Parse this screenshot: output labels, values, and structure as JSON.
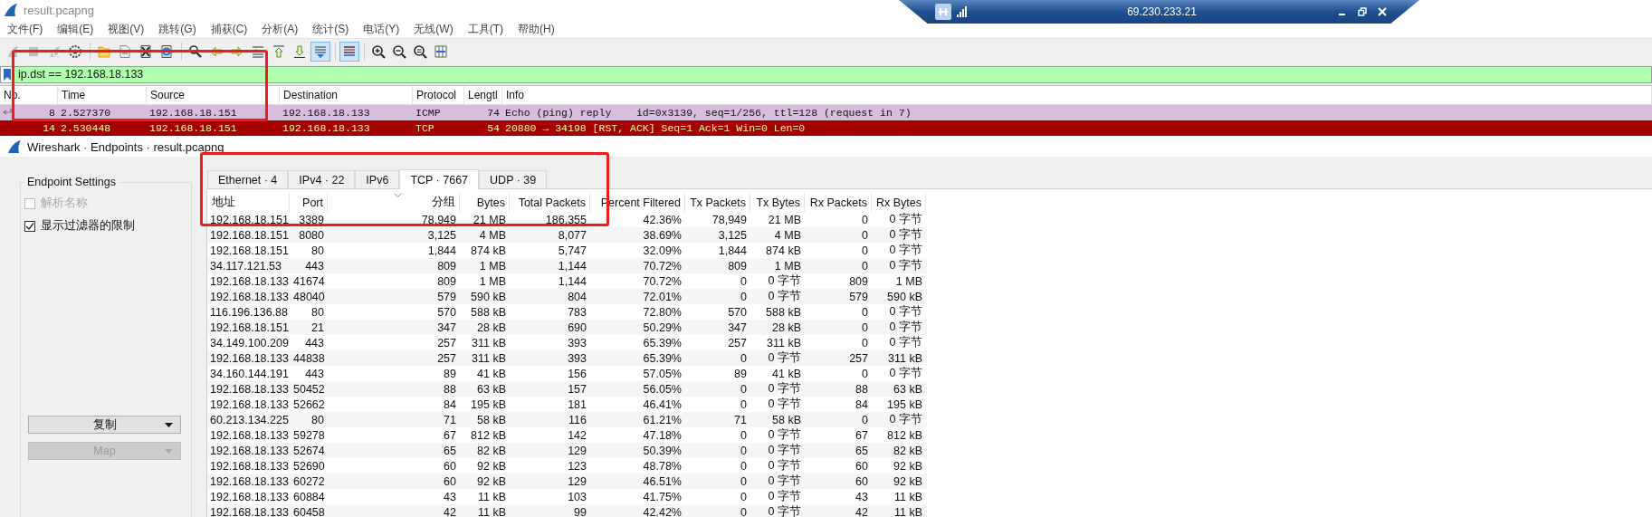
{
  "window": {
    "title": "result.pcapng"
  },
  "remote_bar": {
    "host": "69.230.233.21"
  },
  "menu": [
    "文件(F)",
    "编辑(E)",
    "视图(V)",
    "跳转(G)",
    "捕获(C)",
    "分析(A)",
    "统计(S)",
    "电话(Y)",
    "无线(W)",
    "工具(T)",
    "帮助(H)"
  ],
  "toolbar": [
    [
      {
        "kind": "fin",
        "disabled": true,
        "pressed": false
      },
      {
        "kind": "stop",
        "disabled": true,
        "pressed": false
      },
      {
        "kind": "restart",
        "disabled": true,
        "pressed": false
      },
      {
        "kind": "gear",
        "disabled": false,
        "pressed": false
      }
    ],
    [
      {
        "kind": "folder",
        "disabled": false,
        "pressed": false
      },
      {
        "kind": "document",
        "disabled": false,
        "pressed": false
      },
      {
        "kind": "close",
        "disabled": false,
        "pressed": false
      },
      {
        "kind": "reload",
        "disabled": false,
        "pressed": false
      }
    ],
    [
      {
        "kind": "search",
        "disabled": false,
        "pressed": false
      },
      {
        "kind": "back",
        "disabled": false,
        "pressed": false
      },
      {
        "kind": "forward",
        "disabled": false,
        "pressed": false
      },
      {
        "kind": "jump",
        "disabled": false,
        "pressed": false
      },
      {
        "kind": "first",
        "disabled": false,
        "pressed": false
      },
      {
        "kind": "last",
        "disabled": false,
        "pressed": false
      },
      {
        "kind": "autoscroll",
        "disabled": false,
        "pressed": true
      }
    ],
    [
      {
        "kind": "colorize",
        "disabled": false,
        "pressed": true
      }
    ],
    [
      {
        "kind": "zoom_in",
        "disabled": false,
        "pressed": false
      },
      {
        "kind": "zoom_out",
        "disabled": false,
        "pressed": false
      },
      {
        "kind": "zoom_reset",
        "disabled": false,
        "pressed": false
      },
      {
        "kind": "resize",
        "disabled": false,
        "pressed": false
      }
    ]
  ],
  "display_filter": {
    "value": "ip.dst == 192.168.18.133",
    "highlighted": true
  },
  "packet_list": {
    "columns": [
      "No.",
      "Time",
      "Source",
      "Destination",
      "Protocol",
      "Lengtl",
      "Info"
    ],
    "rows": [
      {
        "color": "#d7bfdb",
        "related": true,
        "cells": [
          "8",
          "2.527370",
          "192.168.18.151",
          "192.168.18.133",
          "ICMP",
          "74",
          "Echo (ping) reply    id=0x3139, seq=1/256, ttl=128 (request in 7)"
        ]
      },
      {
        "color": "#a40000",
        "related": false,
        "cells": [
          "14",
          "2.530448",
          "192.168.18.151",
          "192.168.18.133",
          "TCP",
          "54",
          "20880 → 34198 [RST, ACK] Seq=1 Ack=1 Win=0 Len=0"
        ]
      }
    ]
  },
  "endpoints": {
    "title": "Wireshark · Endpoints · result.pcapng",
    "highlighted": true,
    "settings": {
      "title": "Endpoint Settings",
      "options": [
        {
          "label": "解析名称",
          "checked": false,
          "disabled": true
        },
        {
          "label": "显示过滤器的限制",
          "checked": true,
          "disabled": false
        }
      ],
      "buttons": [
        {
          "label": "复制",
          "disabled": false
        },
        {
          "label": "Map",
          "disabled": true
        }
      ]
    },
    "tabs": [
      {
        "label": "Ethernet · 4",
        "selected": false
      },
      {
        "label": "IPv4 · 22",
        "selected": false
      },
      {
        "label": "IPv6",
        "selected": false
      },
      {
        "label": "TCP · 7667",
        "selected": true
      },
      {
        "label": "UDP · 39",
        "selected": false
      }
    ],
    "table": {
      "columns": [
        {
          "label": "地址",
          "sorted": false
        },
        {
          "label": "Port",
          "sorted": false
        },
        {
          "label": "分组",
          "sorted": true
        },
        {
          "label": "Bytes",
          "sorted": false
        },
        {
          "label": "Total Packets",
          "sorted": false
        },
        {
          "label": "Percent Filtered",
          "sorted": false
        },
        {
          "label": "Tx Packets",
          "sorted": false
        },
        {
          "label": "Tx Bytes",
          "sorted": false
        },
        {
          "label": "Rx Packets",
          "sorted": false
        },
        {
          "label": "Rx Bytes",
          "sorted": false
        }
      ],
      "rows": [
        [
          "192.168.18.151",
          "3389",
          "78,949",
          "21 MB",
          "186,355",
          "42.36%",
          "78,949",
          "21 MB",
          "0",
          "0 字节"
        ],
        [
          "192.168.18.151",
          "8080",
          "3,125",
          "4 MB",
          "8,077",
          "38.69%",
          "3,125",
          "4 MB",
          "0",
          "0 字节"
        ],
        [
          "192.168.18.151",
          "80",
          "1,844",
          "874 kB",
          "5,747",
          "32.09%",
          "1,844",
          "874 kB",
          "0",
          "0 字节"
        ],
        [
          "34.117.121.53",
          "443",
          "809",
          "1 MB",
          "1,144",
          "70.72%",
          "809",
          "1 MB",
          "0",
          "0 字节"
        ],
        [
          "192.168.18.133",
          "41674",
          "809",
          "1 MB",
          "1,144",
          "70.72%",
          "0",
          "0 字节",
          "809",
          "1 MB"
        ],
        [
          "192.168.18.133",
          "48040",
          "579",
          "590 kB",
          "804",
          "72.01%",
          "0",
          "0 字节",
          "579",
          "590 kB"
        ],
        [
          "116.196.136.88",
          "80",
          "570",
          "588 kB",
          "783",
          "72.80%",
          "570",
          "588 kB",
          "0",
          "0 字节"
        ],
        [
          "192.168.18.151",
          "21",
          "347",
          "28 kB",
          "690",
          "50.29%",
          "347",
          "28 kB",
          "0",
          "0 字节"
        ],
        [
          "34.149.100.209",
          "443",
          "257",
          "311 kB",
          "393",
          "65.39%",
          "257",
          "311 kB",
          "0",
          "0 字节"
        ],
        [
          "192.168.18.133",
          "44838",
          "257",
          "311 kB",
          "393",
          "65.39%",
          "0",
          "0 字节",
          "257",
          "311 kB"
        ],
        [
          "34.160.144.191",
          "443",
          "89",
          "41 kB",
          "156",
          "57.05%",
          "89",
          "41 kB",
          "0",
          "0 字节"
        ],
        [
          "192.168.18.133",
          "50452",
          "88",
          "63 kB",
          "157",
          "56.05%",
          "0",
          "0 字节",
          "88",
          "63 kB"
        ],
        [
          "192.168.18.133",
          "52662",
          "84",
          "195 kB",
          "181",
          "46.41%",
          "0",
          "0 字节",
          "84",
          "195 kB"
        ],
        [
          "60.213.134.225",
          "80",
          "71",
          "58 kB",
          "116",
          "61.21%",
          "71",
          "58 kB",
          "0",
          "0 字节"
        ],
        [
          "192.168.18.133",
          "59278",
          "67",
          "812 kB",
          "142",
          "47.18%",
          "0",
          "0 字节",
          "67",
          "812 kB"
        ],
        [
          "192.168.18.133",
          "52674",
          "65",
          "82 kB",
          "129",
          "50.39%",
          "0",
          "0 字节",
          "65",
          "82 kB"
        ],
        [
          "192.168.18.133",
          "52690",
          "60",
          "92 kB",
          "123",
          "48.78%",
          "0",
          "0 字节",
          "60",
          "92 kB"
        ],
        [
          "192.168.18.133",
          "60272",
          "60",
          "92 kB",
          "129",
          "46.51%",
          "0",
          "0 字节",
          "60",
          "92 kB"
        ],
        [
          "192.168.18.133",
          "60884",
          "43",
          "11 kB",
          "103",
          "41.75%",
          "0",
          "0 字节",
          "43",
          "11 kB"
        ],
        [
          "192.168.18.133",
          "60458",
          "42",
          "11 kB",
          "99",
          "42.42%",
          "0",
          "0 字节",
          "42",
          "11 kB"
        ]
      ]
    }
  }
}
